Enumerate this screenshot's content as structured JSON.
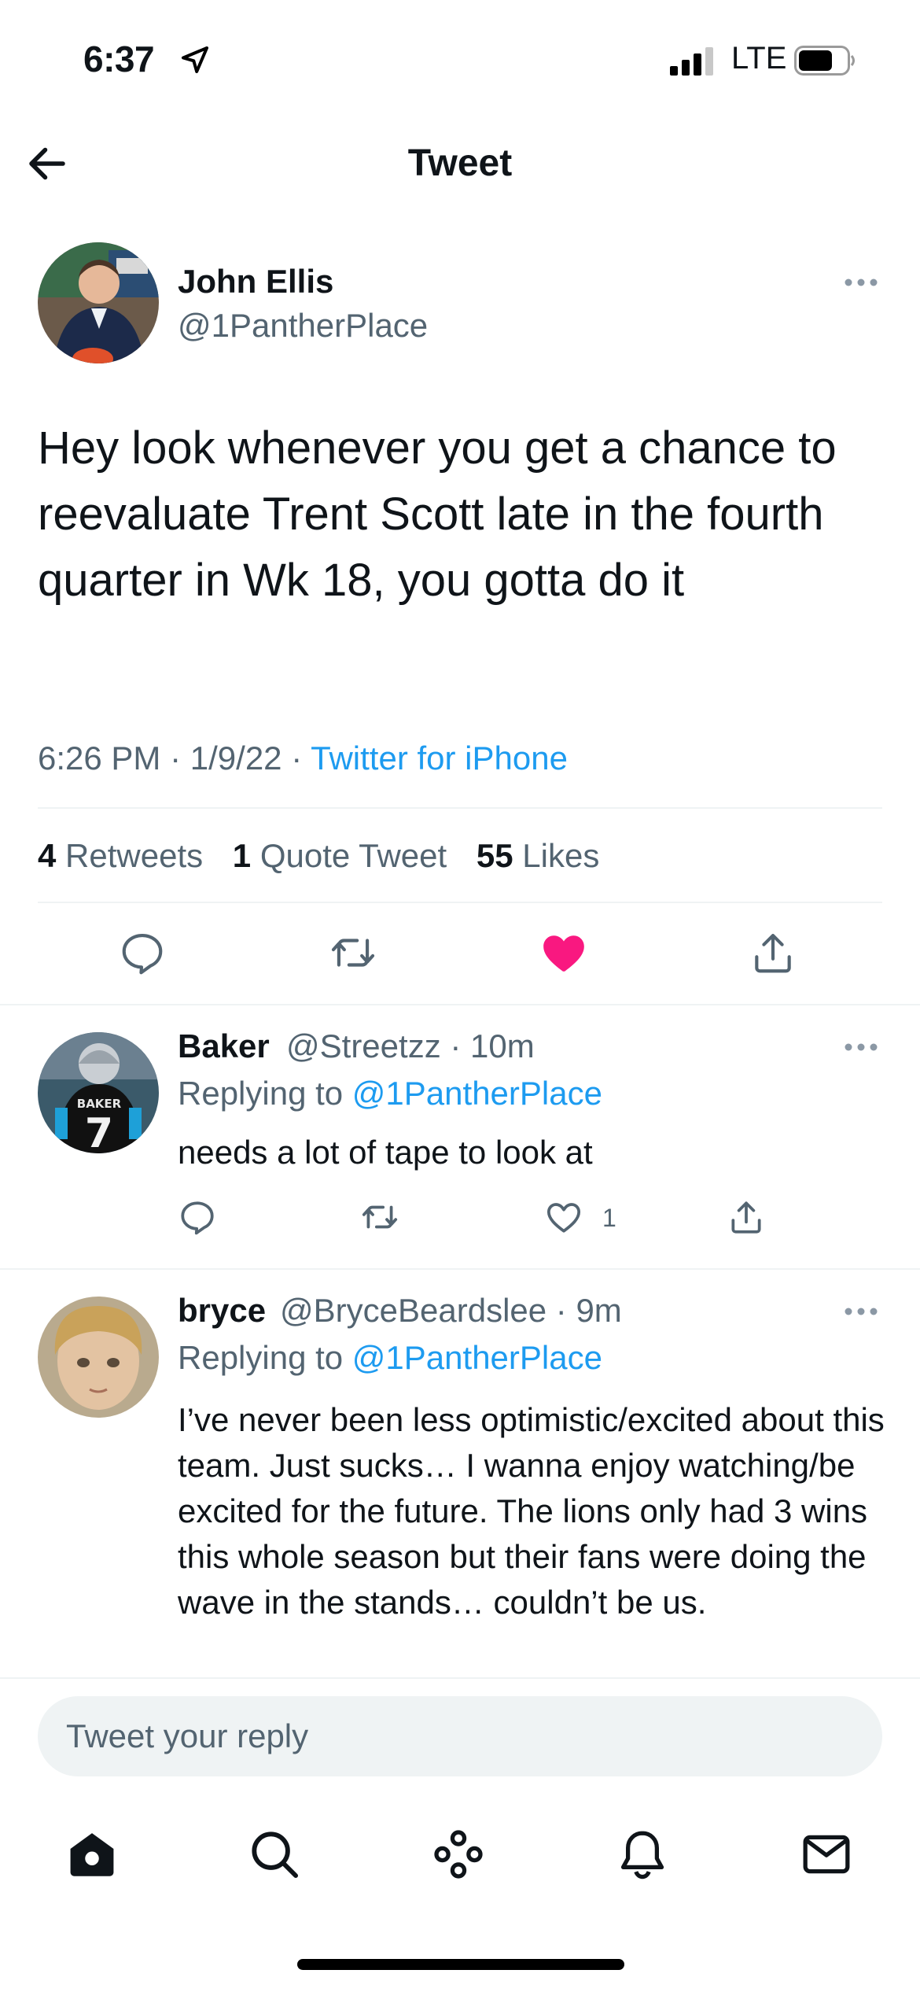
{
  "status_bar": {
    "time": "6:37",
    "network": "LTE",
    "icons": [
      "location-arrow-icon",
      "cellular-signal-icon",
      "battery-icon"
    ]
  },
  "nav": {
    "title": "Tweet",
    "back_icon": "arrow-left-icon"
  },
  "main_tweet": {
    "author_name": "John Ellis",
    "author_handle": "@1PantherPlace",
    "text": "Hey look whenever you get a chance to reevaluate Trent Scott late in the fourth quarter in Wk 18, you gotta do it",
    "time": "6:26 PM",
    "separator": "·",
    "date": "1/9/22",
    "source": "Twitter for iPhone",
    "retweets_count": "4",
    "retweets_label": "Retweets",
    "quotes_count": "1",
    "quotes_label": "Quote Tweet",
    "likes_count": "55",
    "likes_label": "Likes",
    "liked": true,
    "colors": {
      "like": "#f91880",
      "link": "#1d9bf0",
      "secondary": "#536471"
    }
  },
  "replies": [
    {
      "author_name": "Baker",
      "author_handle": "@Streetzz",
      "age": "· 10m",
      "replying_prefix": "Replying to",
      "replying_to": "@1PantherPlace",
      "text": "needs a lot of tape to look at",
      "like_count": "1"
    },
    {
      "author_name": "bryce",
      "author_handle": "@BryceBeardslee",
      "age": "· 9m",
      "replying_prefix": "Replying to",
      "replying_to": "@1PantherPlace",
      "text": "I’ve never been less optimistic/excited about this team. Just sucks… I wanna enjoy watching/be excited for the future. The lions only had 3 wins this whole season but their fans were doing the wave in the stands… couldn’t be us."
    }
  ],
  "composer": {
    "placeholder": "Tweet your reply"
  },
  "tab_bar": {
    "items": [
      "home-icon",
      "search-icon",
      "spaces-icon",
      "notifications-icon",
      "messages-icon"
    ]
  }
}
